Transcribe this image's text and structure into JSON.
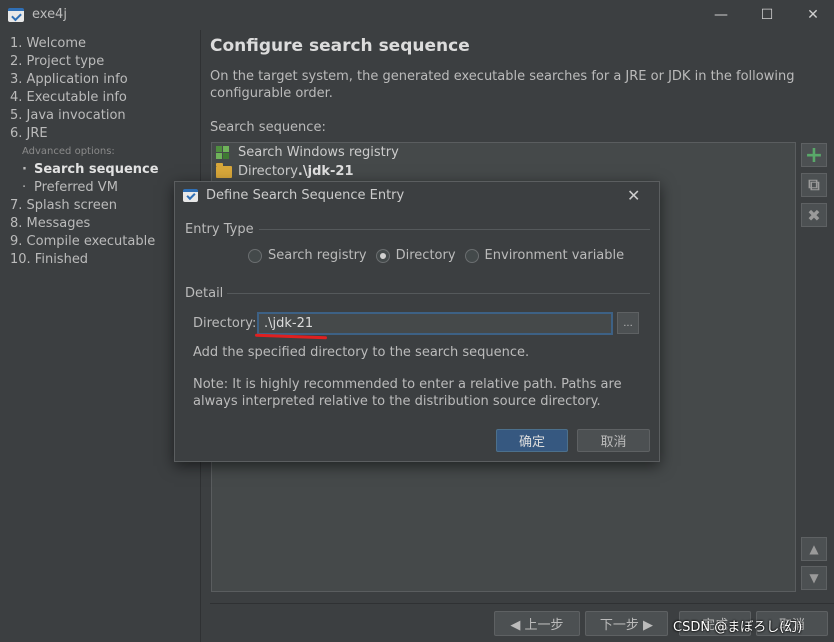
{
  "window": {
    "title": "exe4j",
    "minimize_glyph": "—",
    "maximize_glyph": "☐",
    "close_glyph": "✕"
  },
  "steps": {
    "items": [
      "1. Welcome",
      "2. Project type",
      "3. Application info",
      "4. Executable info",
      "5. Java invocation",
      "6. JRE"
    ],
    "advanced_label": "Advanced options:",
    "sub_items": [
      "Search sequence",
      "Preferred VM"
    ],
    "active_sub": "Search sequence",
    "more_items": [
      "7. Splash screen",
      "8. Messages",
      "9. Compile executable",
      "10. Finished"
    ]
  },
  "main": {
    "title": "Configure search sequence",
    "description": "On the target system, the generated executable searches for a JRE or JDK in the following configurable order.",
    "seq_label": "Search sequence:",
    "seq_items": [
      {
        "icon": "registry-icon",
        "text": "Search Windows registry",
        "bold": ""
      },
      {
        "icon": "folder-icon",
        "text": "Directory ",
        "bold": ".\\jdk-21"
      }
    ]
  },
  "side_buttons": {
    "add": "+",
    "copy": "⧉",
    "delete": "✖",
    "up": "▲",
    "down": "▼"
  },
  "nav": {
    "back": "◀  上一步",
    "next": "下一步  ▶",
    "finish": "完成",
    "cancel": "取消"
  },
  "watermark": "CSDN @まぼろし(幻)",
  "dialog": {
    "title": "Define Search Sequence Entry",
    "close_glyph": "✕",
    "entry_type_label": "Entry Type",
    "radios": [
      {
        "label": "Search registry",
        "checked": false
      },
      {
        "label": "Directory",
        "checked": true
      },
      {
        "label": "Environment variable",
        "checked": false
      }
    ],
    "detail_label": "Detail",
    "directory_label": "Directory:",
    "directory_value": ".\\jdk-21",
    "browse_label": "...",
    "help1": "Add the specified directory to the search sequence.",
    "help2": "Note: It is highly recommended to enter a relative path. Paths are always interpreted relative to the distribution source directory.",
    "ok": "确定",
    "cancel": "取消"
  }
}
